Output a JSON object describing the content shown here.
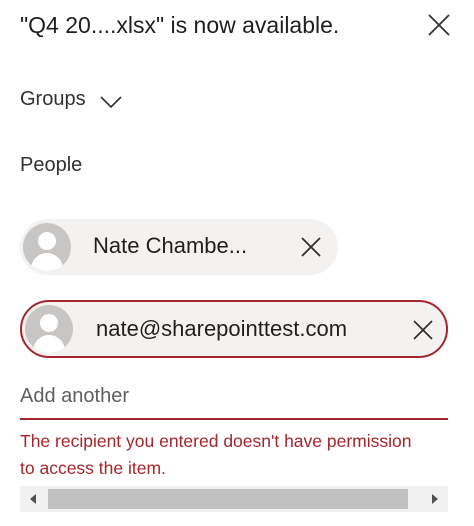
{
  "dialog": {
    "title": "\"Q4 20....xlsx\" is now available."
  },
  "groups": {
    "label": "Groups"
  },
  "people": {
    "label": "People",
    "recipients": [
      {
        "name": "Nate Chambe..."
      },
      {
        "name": "nate@sharepointtest.com",
        "state": "error"
      }
    ]
  },
  "add_input": {
    "placeholder": "Add another"
  },
  "error": {
    "message": "The recipient you entered doesn't have permission to access the item."
  },
  "colors": {
    "error": "#a4262c",
    "chip_background": "#f3f2f1",
    "avatar": "#c8c6c4"
  }
}
